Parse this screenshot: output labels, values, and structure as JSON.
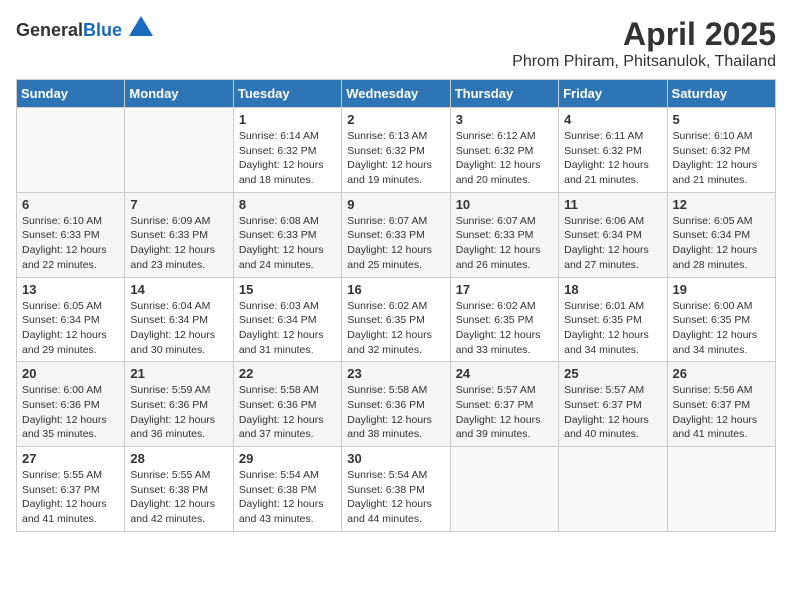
{
  "header": {
    "logo_general": "General",
    "logo_blue": "Blue",
    "main_title": "April 2025",
    "sub_title": "Phrom Phiram, Phitsanulok, Thailand"
  },
  "calendar": {
    "days_of_week": [
      "Sunday",
      "Monday",
      "Tuesday",
      "Wednesday",
      "Thursday",
      "Friday",
      "Saturday"
    ],
    "weeks": [
      [
        {
          "day": "",
          "info": ""
        },
        {
          "day": "",
          "info": ""
        },
        {
          "day": "1",
          "info": "Sunrise: 6:14 AM\nSunset: 6:32 PM\nDaylight: 12 hours\nand 18 minutes."
        },
        {
          "day": "2",
          "info": "Sunrise: 6:13 AM\nSunset: 6:32 PM\nDaylight: 12 hours\nand 19 minutes."
        },
        {
          "day": "3",
          "info": "Sunrise: 6:12 AM\nSunset: 6:32 PM\nDaylight: 12 hours\nand 20 minutes."
        },
        {
          "day": "4",
          "info": "Sunrise: 6:11 AM\nSunset: 6:32 PM\nDaylight: 12 hours\nand 21 minutes."
        },
        {
          "day": "5",
          "info": "Sunrise: 6:10 AM\nSunset: 6:32 PM\nDaylight: 12 hours\nand 21 minutes."
        }
      ],
      [
        {
          "day": "6",
          "info": "Sunrise: 6:10 AM\nSunset: 6:33 PM\nDaylight: 12 hours\nand 22 minutes."
        },
        {
          "day": "7",
          "info": "Sunrise: 6:09 AM\nSunset: 6:33 PM\nDaylight: 12 hours\nand 23 minutes."
        },
        {
          "day": "8",
          "info": "Sunrise: 6:08 AM\nSunset: 6:33 PM\nDaylight: 12 hours\nand 24 minutes."
        },
        {
          "day": "9",
          "info": "Sunrise: 6:07 AM\nSunset: 6:33 PM\nDaylight: 12 hours\nand 25 minutes."
        },
        {
          "day": "10",
          "info": "Sunrise: 6:07 AM\nSunset: 6:33 PM\nDaylight: 12 hours\nand 26 minutes."
        },
        {
          "day": "11",
          "info": "Sunrise: 6:06 AM\nSunset: 6:34 PM\nDaylight: 12 hours\nand 27 minutes."
        },
        {
          "day": "12",
          "info": "Sunrise: 6:05 AM\nSunset: 6:34 PM\nDaylight: 12 hours\nand 28 minutes."
        }
      ],
      [
        {
          "day": "13",
          "info": "Sunrise: 6:05 AM\nSunset: 6:34 PM\nDaylight: 12 hours\nand 29 minutes."
        },
        {
          "day": "14",
          "info": "Sunrise: 6:04 AM\nSunset: 6:34 PM\nDaylight: 12 hours\nand 30 minutes."
        },
        {
          "day": "15",
          "info": "Sunrise: 6:03 AM\nSunset: 6:34 PM\nDaylight: 12 hours\nand 31 minutes."
        },
        {
          "day": "16",
          "info": "Sunrise: 6:02 AM\nSunset: 6:35 PM\nDaylight: 12 hours\nand 32 minutes."
        },
        {
          "day": "17",
          "info": "Sunrise: 6:02 AM\nSunset: 6:35 PM\nDaylight: 12 hours\nand 33 minutes."
        },
        {
          "day": "18",
          "info": "Sunrise: 6:01 AM\nSunset: 6:35 PM\nDaylight: 12 hours\nand 34 minutes."
        },
        {
          "day": "19",
          "info": "Sunrise: 6:00 AM\nSunset: 6:35 PM\nDaylight: 12 hours\nand 34 minutes."
        }
      ],
      [
        {
          "day": "20",
          "info": "Sunrise: 6:00 AM\nSunset: 6:36 PM\nDaylight: 12 hours\nand 35 minutes."
        },
        {
          "day": "21",
          "info": "Sunrise: 5:59 AM\nSunset: 6:36 PM\nDaylight: 12 hours\nand 36 minutes."
        },
        {
          "day": "22",
          "info": "Sunrise: 5:58 AM\nSunset: 6:36 PM\nDaylight: 12 hours\nand 37 minutes."
        },
        {
          "day": "23",
          "info": "Sunrise: 5:58 AM\nSunset: 6:36 PM\nDaylight: 12 hours\nand 38 minutes."
        },
        {
          "day": "24",
          "info": "Sunrise: 5:57 AM\nSunset: 6:37 PM\nDaylight: 12 hours\nand 39 minutes."
        },
        {
          "day": "25",
          "info": "Sunrise: 5:57 AM\nSunset: 6:37 PM\nDaylight: 12 hours\nand 40 minutes."
        },
        {
          "day": "26",
          "info": "Sunrise: 5:56 AM\nSunset: 6:37 PM\nDaylight: 12 hours\nand 41 minutes."
        }
      ],
      [
        {
          "day": "27",
          "info": "Sunrise: 5:55 AM\nSunset: 6:37 PM\nDaylight: 12 hours\nand 41 minutes."
        },
        {
          "day": "28",
          "info": "Sunrise: 5:55 AM\nSunset: 6:38 PM\nDaylight: 12 hours\nand 42 minutes."
        },
        {
          "day": "29",
          "info": "Sunrise: 5:54 AM\nSunset: 6:38 PM\nDaylight: 12 hours\nand 43 minutes."
        },
        {
          "day": "30",
          "info": "Sunrise: 5:54 AM\nSunset: 6:38 PM\nDaylight: 12 hours\nand 44 minutes."
        },
        {
          "day": "",
          "info": ""
        },
        {
          "day": "",
          "info": ""
        },
        {
          "day": "",
          "info": ""
        }
      ]
    ]
  }
}
